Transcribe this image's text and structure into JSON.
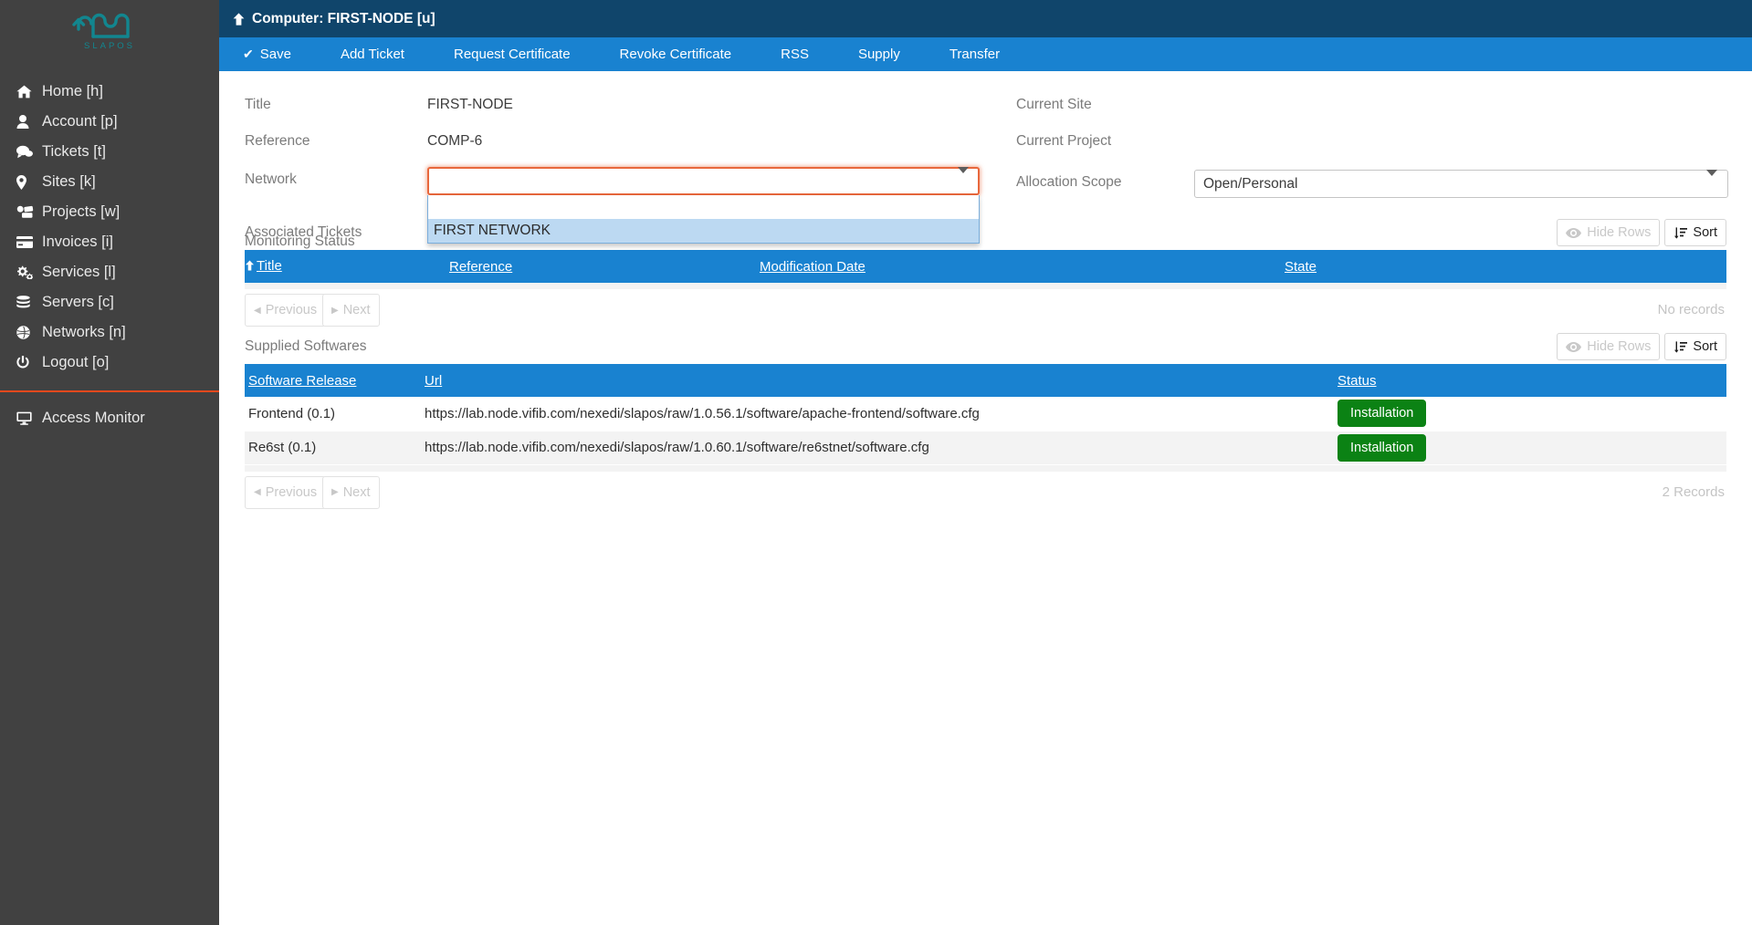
{
  "brand": {
    "name": "SLAPOS",
    "logo_icon": "slapos-cloud-logo"
  },
  "sidebar": {
    "items": [
      {
        "label": "Home [h]",
        "icon": "home-icon"
      },
      {
        "label": "Account [p]",
        "icon": "user-icon"
      },
      {
        "label": "Tickets [t]",
        "icon": "comments-icon"
      },
      {
        "label": "Sites [k]",
        "icon": "map-marker-icon"
      },
      {
        "label": "Projects [w]",
        "icon": "projects-icon"
      },
      {
        "label": "Invoices [i]",
        "icon": "credit-card-icon"
      },
      {
        "label": "Services [l]",
        "icon": "gears-icon"
      },
      {
        "label": "Servers [c]",
        "icon": "database-icon"
      },
      {
        "label": "Networks [n]",
        "icon": "globe-icon"
      },
      {
        "label": "Logout [o]",
        "icon": "power-icon"
      }
    ],
    "footer_items": [
      {
        "label": "Access Monitor",
        "icon": "desktop-icon"
      }
    ]
  },
  "header": {
    "title": "Computer: FIRST-NODE [u]",
    "up_icon": "arrow-up-icon"
  },
  "toolbar": {
    "items": [
      {
        "label": "Save",
        "icon": "check-icon"
      },
      {
        "label": "Add Ticket"
      },
      {
        "label": "Request Certificate"
      },
      {
        "label": "Revoke Certificate"
      },
      {
        "label": "RSS"
      },
      {
        "label": "Supply"
      },
      {
        "label": "Transfer"
      }
    ]
  },
  "form": {
    "title": {
      "label": "Title",
      "value": "FIRST-NODE"
    },
    "reference": {
      "label": "Reference",
      "value": "COMP-6"
    },
    "network": {
      "label": "Network",
      "value": "",
      "expanded": true,
      "options": [
        "",
        "FIRST NETWORK"
      ],
      "highlighted_option": "FIRST NETWORK"
    },
    "monitoring_status": {
      "label": "Monitoring Status",
      "value": ""
    },
    "current_site": {
      "label": "Current Site",
      "value": ""
    },
    "current_project": {
      "label": "Current Project",
      "value": ""
    },
    "allocation_scope": {
      "label": "Allocation Scope",
      "value": "Open/Personal"
    }
  },
  "associated_tickets": {
    "title": "Associated Tickets",
    "hide_rows_label": "Hide Rows",
    "sort_label": "Sort",
    "columns": [
      "Title",
      "Reference",
      "Modification Date",
      "State"
    ],
    "sorted_column": "Title",
    "rows": [],
    "previous_label": "Previous",
    "next_label": "Next",
    "record_count": "No records"
  },
  "supplied_softwares": {
    "title": "Supplied Softwares",
    "hide_rows_label": "Hide Rows",
    "sort_label": "Sort",
    "columns": [
      "Software Release",
      "Url",
      "Status"
    ],
    "rows": [
      {
        "software_release": "Frontend (0.1)",
        "url": "https://lab.node.vifib.com/nexedi/slapos/raw/1.0.56.1/software/apache-frontend/software.cfg",
        "status": "Installation"
      },
      {
        "software_release": "Re6st (0.1)",
        "url": "https://lab.node.vifib.com/nexedi/slapos/raw/1.0.60.1/software/re6stnet/software.cfg",
        "status": "Installation"
      }
    ],
    "previous_label": "Previous",
    "next_label": "Next",
    "record_count": "2 Records"
  },
  "colors": {
    "sidebar_bg": "#414141",
    "header_bg": "#10456b",
    "toolbar_bg": "#1982d0",
    "accent_orange": "#e8491d",
    "focus_orange": "#e8673c",
    "table_header_blue": "#1982d0",
    "status_green": "#0b8214",
    "option_highlight": "#bcd9f2",
    "brand_teal": "#12868f"
  }
}
